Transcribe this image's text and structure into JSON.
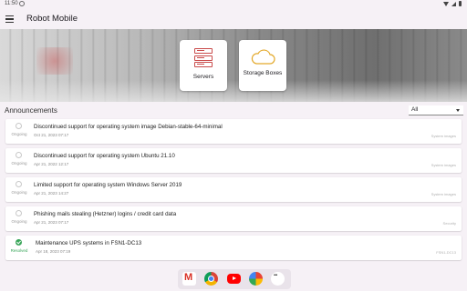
{
  "statusbar": {
    "time": "11:50",
    "notification_icon": "settings-notification-icon"
  },
  "app": {
    "title": "Robot Mobile"
  },
  "tiles": [
    {
      "label": "Servers",
      "icon": "server-icon"
    },
    {
      "label": "Storage Boxes",
      "icon": "cloud-storage-icon"
    }
  ],
  "announcements": {
    "title": "Announcements",
    "filter_value": "All",
    "items": [
      {
        "status": "Ongoing",
        "title": "Discontinued support for operating system image Debian-stable-64-minimal",
        "date": "Oct 21, 2023 07:17",
        "category": "System images"
      },
      {
        "status": "Ongoing",
        "title": "Discontinued support for operating system Ubuntu 21.10",
        "date": "Apr 21, 2022 12:17",
        "category": "System images"
      },
      {
        "status": "Ongoing",
        "title": "Limited support for operating system Windows Server 2019",
        "date": "Apr 21, 2023 14:27",
        "category": "System images"
      },
      {
        "status": "Ongoing",
        "title": "Phishing mails stealing (Hetzner) logins / credit card data",
        "date": "Apr 21, 2023 07:17",
        "category": "Security"
      },
      {
        "status": "Resolved",
        "title": "Maintenance UPS systems in FSN1-DC13",
        "date": "Apr 18, 2023 07:19",
        "category": "FSN1-DC13"
      }
    ]
  },
  "colors": {
    "resolved": "#3aa65a",
    "brand_red": "#c94a4a"
  },
  "dock": [
    "gmail-icon",
    "chrome-icon",
    "youtube-icon",
    "photos-icon",
    "app-drawer-icon"
  ]
}
